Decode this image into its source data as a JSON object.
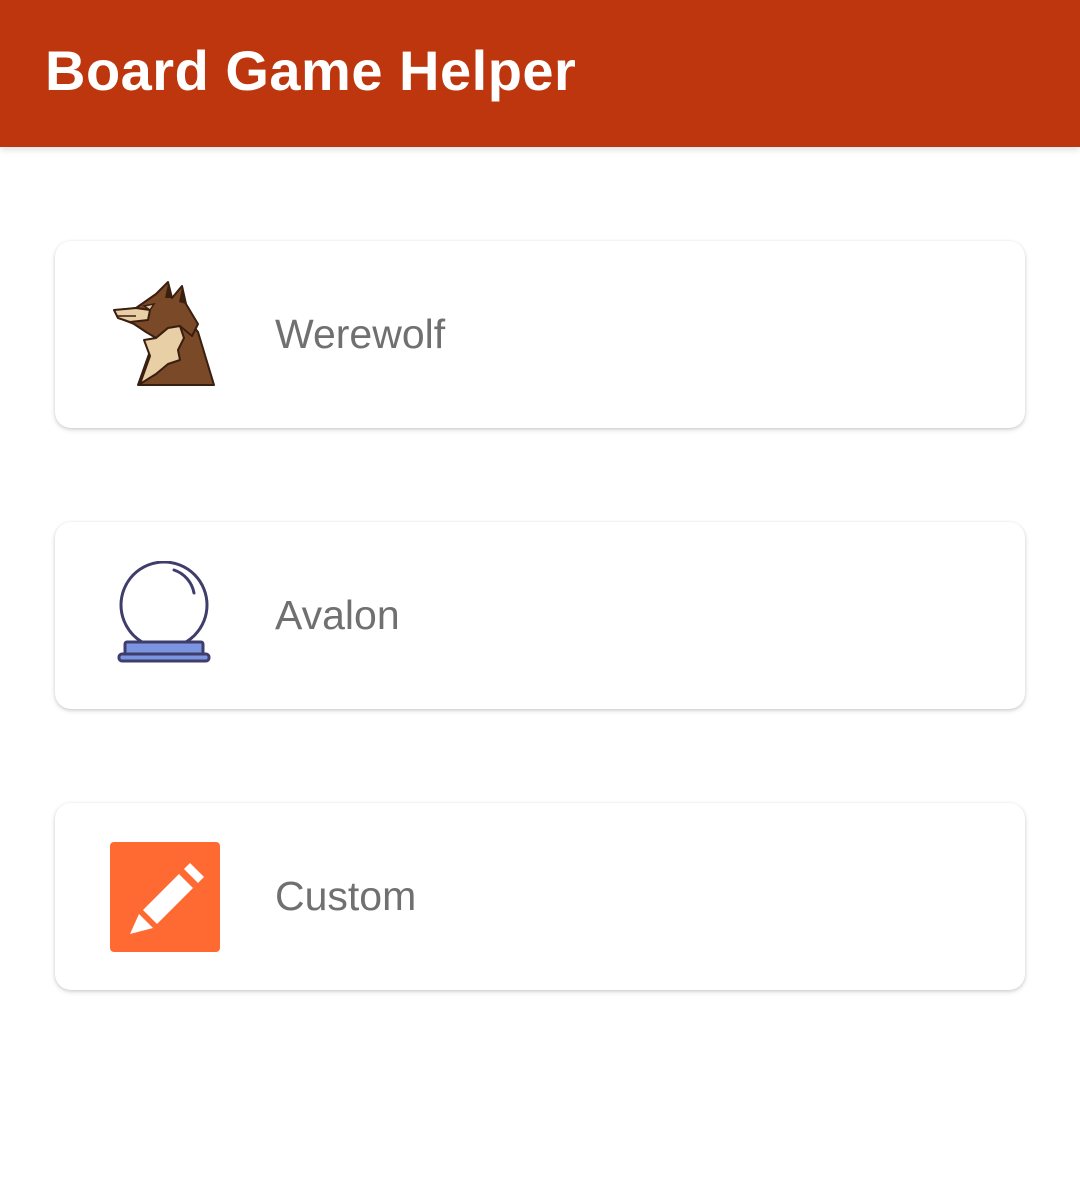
{
  "app_bar": {
    "title": "Board Game Helper",
    "color": "#bd360e"
  },
  "games": [
    {
      "label": "Werewolf",
      "icon": "werewolf-icon"
    },
    {
      "label": "Avalon",
      "icon": "crystal-ball-icon"
    },
    {
      "label": "Custom",
      "icon": "pencil-edit-icon",
      "icon_color": "#ff6a33"
    }
  ]
}
